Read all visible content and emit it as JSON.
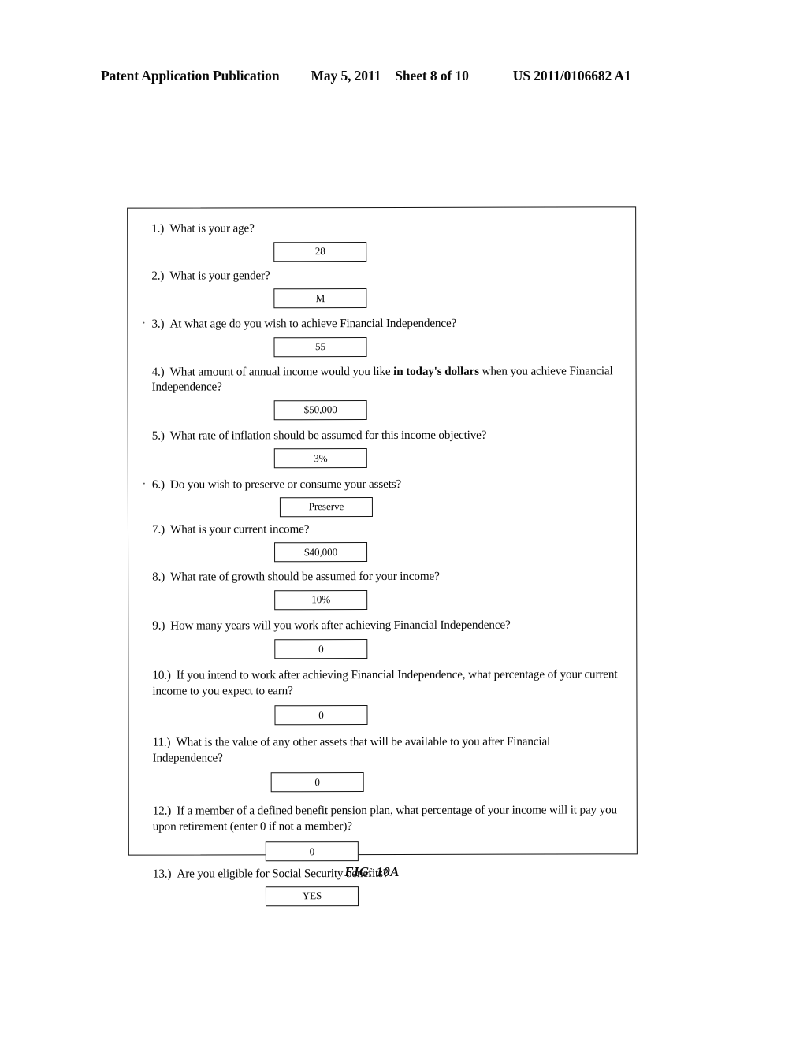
{
  "header": {
    "publication": "Patent Application Publication",
    "date": "May 5, 2011",
    "sheet": "Sheet 8 of 10",
    "patent_number": "US 2011/0106682 A1"
  },
  "figure": {
    "caption": "FIG. 10A"
  },
  "form": {
    "questions": [
      {
        "number": "1.)",
        "text": "What is your age?",
        "value": "28"
      },
      {
        "number": "2.)",
        "text": "What is your gender?",
        "value": "M"
      },
      {
        "number": "3.)",
        "text": "At what age do you wish to achieve Financial Independence?",
        "value": "55"
      },
      {
        "number": "4.)",
        "text_before_bold": "What amount of annual income would you like ",
        "text_bold": "in today's dollars",
        "text_after_bold": " when you achieve Financial Independence?",
        "value": "$50,000"
      },
      {
        "number": "5.)",
        "text": "What rate of inflation should be assumed for this income objective?",
        "value": "3%"
      },
      {
        "number": "6.)",
        "text": "Do you wish to preserve or consume your assets?",
        "value": "Preserve"
      },
      {
        "number": "7.)",
        "text": "What is your current income?",
        "value": "$40,000"
      },
      {
        "number": "8.)",
        "text": "What rate of growth should be assumed for your income?",
        "value": "10%"
      },
      {
        "number": "9.)",
        "text": "How many years will you work after achieving Financial Independence?",
        "value": "0"
      },
      {
        "number": "10.)",
        "text": "If you intend to work after achieving Financial Independence, what percentage of your current income to you expect to earn?",
        "value": "0"
      },
      {
        "number": "11.)",
        "text": "What is the value of any other assets that will be available to you after Financial Independence?",
        "value": "0"
      },
      {
        "number": "12.)",
        "text": "If a member of a defined benefit pension plan, what percentage of your income will it pay you upon retirement (enter 0 if not a member)?",
        "value": "0"
      },
      {
        "number": "13.)",
        "text": "Are you eligible for Social Security benefits?",
        "value": "YES"
      }
    ]
  }
}
